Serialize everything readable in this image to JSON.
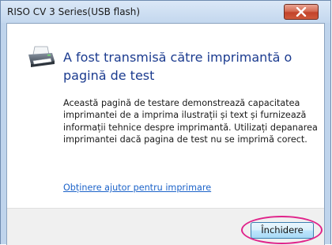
{
  "window": {
    "title": "RISO CV 3 Series(USB flash)"
  },
  "message": {
    "heading": "A fost transmisă către imprimantă o pagină de test",
    "body": "Această pagină de testare demonstrează capacitatea imprimantei de a imprima ilustrații și text și furnizează informații tehnice despre imprimantă. Utilizați depanarea imprimantei dacă pagina de test nu se imprimă corect.",
    "help_link": "Obținere ajutor pentru imprimare"
  },
  "footer": {
    "close_button_label": "Închidere"
  },
  "icons": {
    "title_close": "close-icon",
    "main": "printer-icon"
  },
  "colors": {
    "heading": "#1b3b8f",
    "link": "#1c63c9",
    "highlight": "#e0238a",
    "close_button_bg": "#c2432a"
  }
}
